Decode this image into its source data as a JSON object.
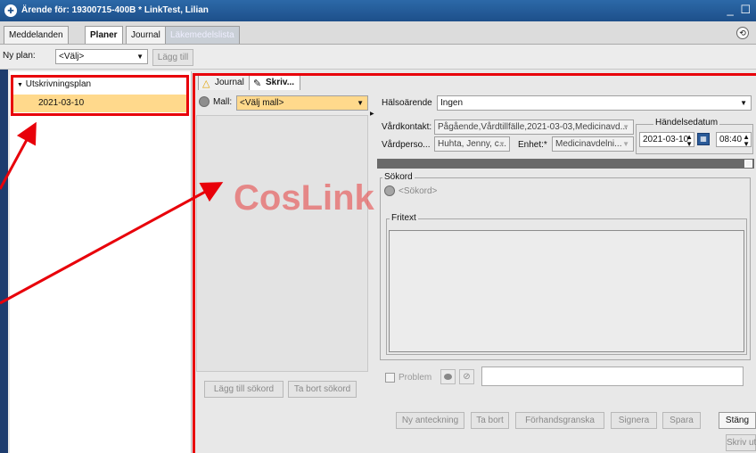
{
  "window": {
    "title": "Ärende för: 19300715-400B * LinkTest, Lilian",
    "controls": "_ ☐"
  },
  "top_tabs": [
    "Meddelanden",
    "Planer",
    "Journal",
    "Läkemedelslista"
  ],
  "plan_row": {
    "label": "Ny plan:",
    "select_value": "<Välj>",
    "add_button": "Lägg till"
  },
  "tree": {
    "node": "Utskrivningsplan",
    "selected_item": "2021-03-10"
  },
  "main_tabs": [
    "Journal",
    "Skriv..."
  ],
  "template": {
    "label": "Mall:",
    "value": "<Välj mall>"
  },
  "health_issue": {
    "label": "Hälsoärende",
    "value": "Ingen"
  },
  "care_contact": {
    "label": "Vårdkontakt:",
    "value": "Pågående,Vårdtillfälle,2021-03-03,Medicinavd..."
  },
  "care_staff": {
    "label": "Vårdperso...",
    "value": "Huhta, Jenny, c..."
  },
  "unit": {
    "label": "Enhet:*",
    "value": "Medicinavdelni..."
  },
  "event_date": {
    "label": "Händelsedatum",
    "date": "2021-03-10",
    "time": "08:40"
  },
  "keyword": {
    "label": "Sökord",
    "placeholder": "<Sökord>"
  },
  "freetext": {
    "label": "Fritext"
  },
  "problem": {
    "label": "Problem"
  },
  "watermark": "CosLink",
  "keyword_buttons": {
    "add": "Lägg till sökord",
    "remove": "Ta bort sökord"
  },
  "bottom_buttons": {
    "new_note": "Ny anteckning",
    "delete": "Ta bort",
    "preview": "Förhandsgranska",
    "sign": "Signera",
    "save": "Spara",
    "close": "Stäng",
    "print": "Skriv ut"
  },
  "colors": {
    "title_bar": "#1d4f8a",
    "highlight": "#ffd98c",
    "annotation_red": "#e8000a",
    "navy_strip": "#1d3c6e"
  }
}
